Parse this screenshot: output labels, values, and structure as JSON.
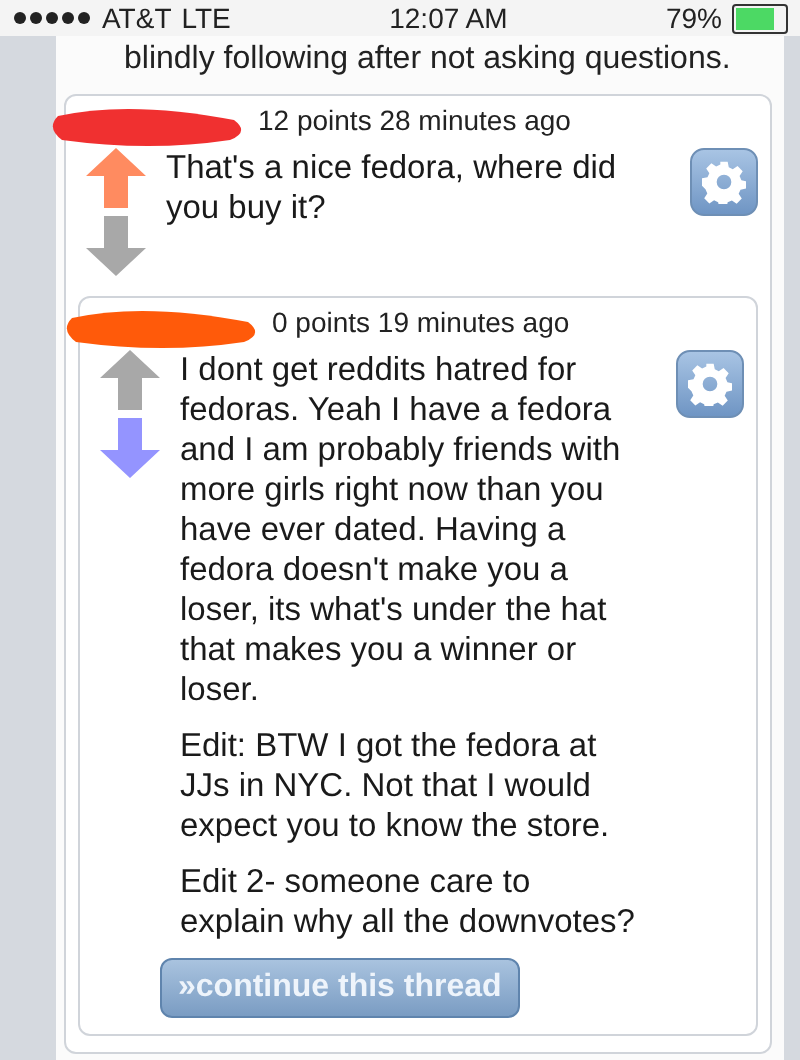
{
  "status_bar": {
    "carrier": "AT&T",
    "network": "LTE",
    "time": "12:07 AM",
    "battery": "79%"
  },
  "previous_text": "blindly following after not asking questions.",
  "comments": [
    {
      "meta": "12 points 28 minutes ago",
      "upvoted": true,
      "downvoted": false,
      "paragraphs": [
        "That's a nice fedora, where did you buy it?"
      ],
      "children": [
        {
          "meta": "0 points 19 minutes ago",
          "upvoted": false,
          "downvoted": true,
          "paragraphs": [
            "I dont get reddits hatred for fedoras. Yeah I have a fedora and I am probably friends with more girls right now than you have ever dated. Having a fedora doesn't make you a loser, its what's under the hat that makes you a winner or loser.",
            "Edit: BTW I got the fedora at JJs in NYC. Not that I would expect you to know the store.",
            "Edit 2- someone care to explain why all the downvotes?"
          ],
          "button": "»continue this thread"
        }
      ]
    }
  ]
}
